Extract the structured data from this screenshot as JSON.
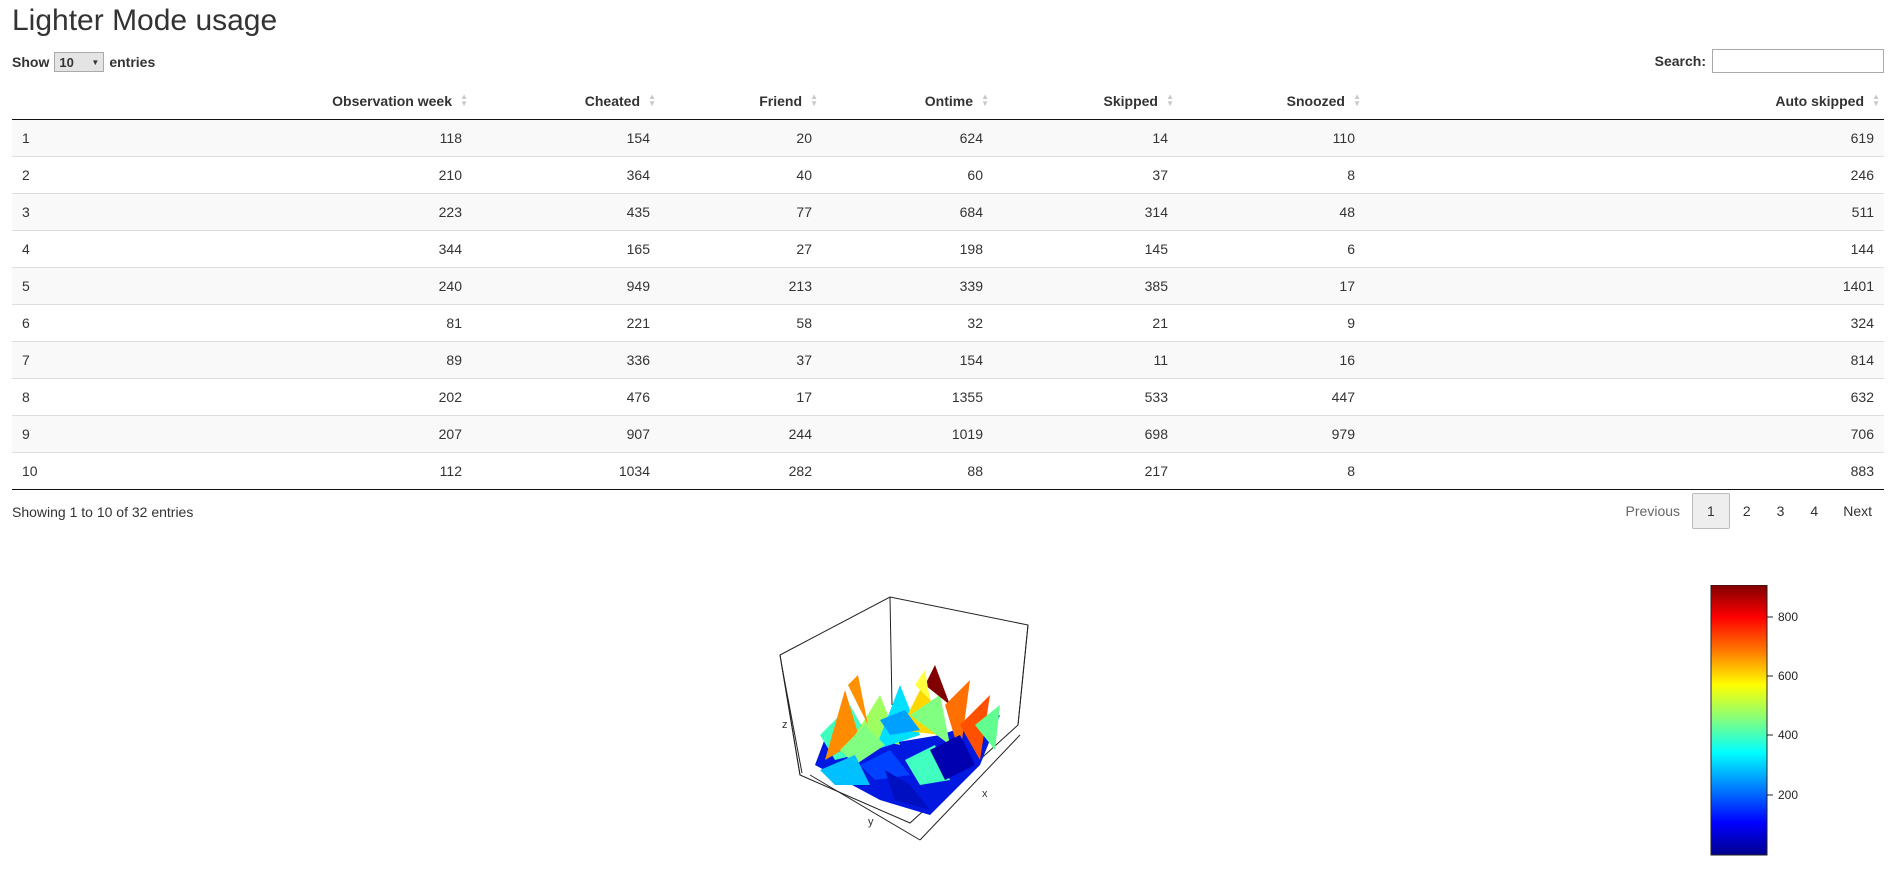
{
  "page": {
    "title": "Lighter Mode usage"
  },
  "length_control": {
    "show_label": "Show",
    "selected": "10",
    "entries_label": "entries"
  },
  "search": {
    "label": "Search:",
    "value": ""
  },
  "table": {
    "columns": [
      "",
      "Observation week",
      "Cheated",
      "Friend",
      "Ontime",
      "Skipped",
      "Snoozed",
      "Auto skipped"
    ],
    "rows": [
      [
        "1",
        "118",
        "154",
        "20",
        "624",
        "14",
        "110",
        "619"
      ],
      [
        "2",
        "210",
        "364",
        "40",
        "60",
        "37",
        "8",
        "246"
      ],
      [
        "3",
        "223",
        "435",
        "77",
        "684",
        "314",
        "48",
        "511"
      ],
      [
        "4",
        "344",
        "165",
        "27",
        "198",
        "145",
        "6",
        "144"
      ],
      [
        "5",
        "240",
        "949",
        "213",
        "339",
        "385",
        "17",
        "1401"
      ],
      [
        "6",
        "81",
        "221",
        "58",
        "32",
        "21",
        "9",
        "324"
      ],
      [
        "7",
        "89",
        "336",
        "37",
        "154",
        "11",
        "16",
        "814"
      ],
      [
        "8",
        "202",
        "476",
        "17",
        "1355",
        "533",
        "447",
        "632"
      ],
      [
        "9",
        "207",
        "907",
        "244",
        "1019",
        "698",
        "979",
        "706"
      ],
      [
        "10",
        "112",
        "1034",
        "282",
        "88",
        "217",
        "8",
        "883"
      ]
    ]
  },
  "info": "Showing 1 to 10 of 32 entries",
  "pagination": {
    "previous": "Previous",
    "pages": [
      "1",
      "2",
      "3",
      "4"
    ],
    "current": "1",
    "next": "Next"
  },
  "plot": {
    "axis_labels": {
      "x": "x",
      "y": "y",
      "z": "z"
    },
    "colorbar_ticks": [
      "800",
      "600",
      "400",
      "200"
    ],
    "colorbar_colors": [
      "#800000",
      "#ff0000",
      "#ff8000",
      "#ffff00",
      "#80ff80",
      "#00ffff",
      "#0080ff",
      "#0000ff",
      "#00008f"
    ]
  }
}
